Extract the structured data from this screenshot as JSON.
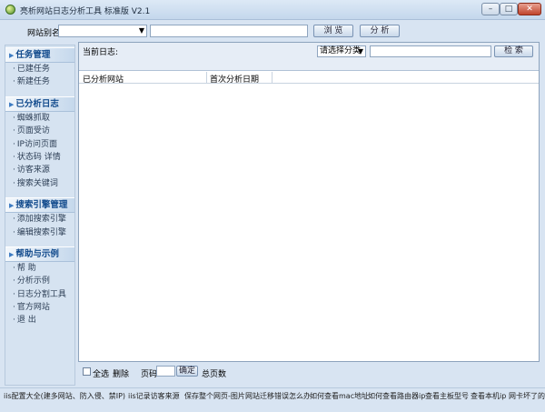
{
  "window": {
    "title": "亮析网站日志分析工具 标准版 V2.1",
    "min_label": "–",
    "max_label": "□",
    "close_label": "✕"
  },
  "toolbar": {
    "site_alias_label": "网站别名:",
    "site_select_value": "",
    "path_input_value": "",
    "browse_label": "浏 览",
    "analyze_label": "分 析"
  },
  "sidebar": {
    "sections": [
      {
        "title": "任务管理",
        "items": [
          "已建任务",
          "新建任务"
        ]
      },
      {
        "title": "已分析日志",
        "items": [
          "蜘蛛抓取",
          "页面受访",
          "IP访问页面",
          "状态码  详情",
          "访客来源",
          "搜索关键词"
        ]
      },
      {
        "title": "搜索引擎管理",
        "items": [
          "添加搜索引擎",
          "编辑搜索引擎"
        ]
      },
      {
        "title": "帮助与示例",
        "items": [
          "帮  助",
          "分析示例",
          "日志分割工具",
          "官方网站",
          "退  出"
        ]
      }
    ]
  },
  "main": {
    "current_log_label": "当前日志:",
    "category_select": "请选择分类",
    "search_input_value": "",
    "search_label": "检  索",
    "columns": [
      "已分析网站",
      "首次分析日期"
    ]
  },
  "pager": {
    "select_all_label": "全选",
    "delete_label": "删除",
    "page_label": "页码",
    "page_input_value": "",
    "ok_label": "确定",
    "total_label": "总页数"
  },
  "footer": {
    "links": [
      "iis配置大全(建多网站、防入侵、禁IP)",
      "iis记录访客来源",
      "保存整个网页-图片",
      "网站迁移错误怎么办",
      "如何查看mac地址",
      "如何查看路由器ip",
      "查看主板型号",
      "查看本机ip",
      "网卡坏了的"
    ]
  },
  "colors": {
    "accent": "#114a8c",
    "background": "#d8e4f2",
    "panel": "#ffffff"
  }
}
